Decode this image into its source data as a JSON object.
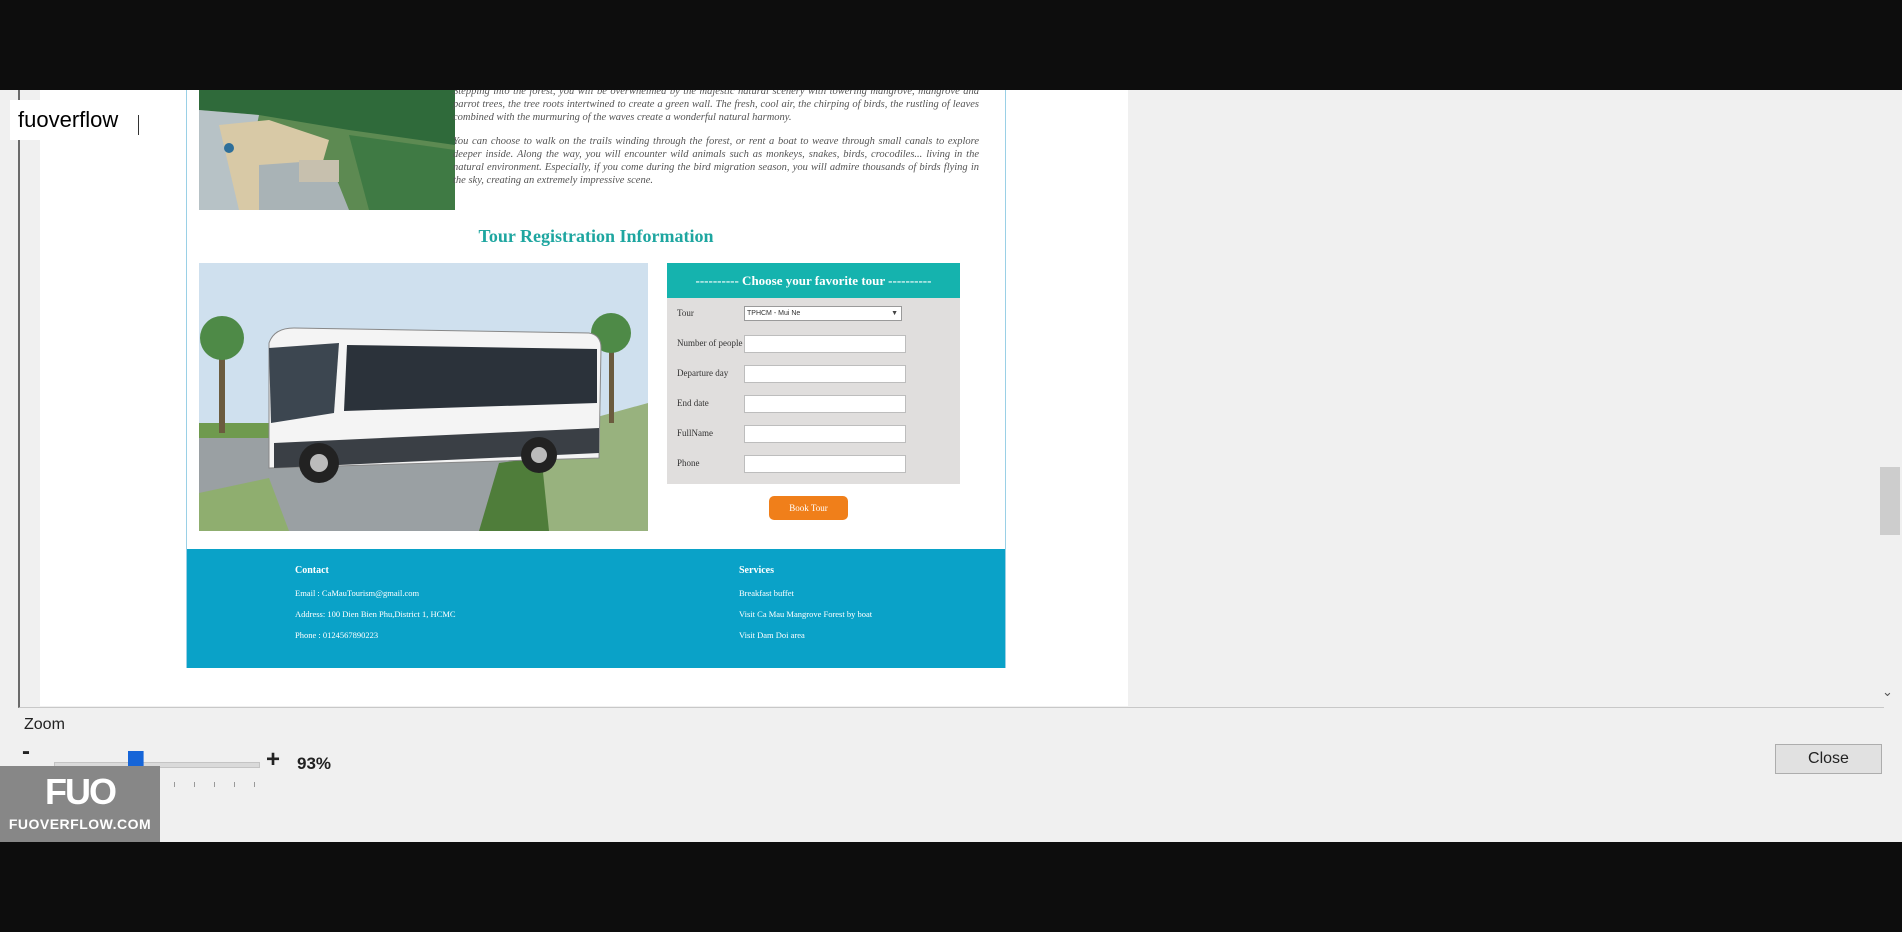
{
  "watermark": {
    "name": "fuoverflow"
  },
  "document": {
    "intro_paragraph_1": "Stepping into the forest, you will be overwhelmed by the majestic natural scenery with towering mangrove, mangrove and parrot trees, the tree roots intertwined to create a green wall. The fresh, cool air, the chirping of birds, the rustling of leaves combined with the murmuring of the waves create a wonderful natural harmony.",
    "intro_paragraph_2": "You can choose to walk on the trails winding through the forest, or rent a boat to weave through small canals to explore deeper inside. Along the way, you will encounter wild animals such as monkeys, snakes, birds, crocodiles... living in the natural environment. Especially, if you come during the bird migration season, you will admire thousands of birds flying in the sky, creating an extremely impressive scene.",
    "registration_title": "Tour Registration Information",
    "form": {
      "header": "---------- Choose your favorite tour ----------",
      "tour_label": "Tour",
      "tour_selected": "TPHCM - Mui Ne",
      "people_label": "Number of people",
      "departure_label": "Departure day",
      "end_label": "End date",
      "fullname_label": "FullName",
      "phone_label": "Phone",
      "book_button": "Book Tour"
    },
    "footer": {
      "contact_title": "Contact",
      "email": "Email : CaMauTourism@gmail.com",
      "address": "Address: 100 Dien Bien Phu,District 1, HCMC",
      "phone": "Phone : 0124567890223",
      "services_title": "Services",
      "service_1": "Breakfast buffet",
      "service_2": "Visit Ca Mau Mangrove Forest by boat",
      "service_3": "Visit Dam Doi area"
    }
  },
  "zoom": {
    "label": "Zoom",
    "minus": "-",
    "plus": "+",
    "value": "93%",
    "level_fraction": 0.4
  },
  "close_button": "Close",
  "logo": {
    "mark": "FUO",
    "site": "FUOVERFLOW.COM"
  },
  "colors": {
    "accent_teal": "#15b3ae",
    "footer_blue": "#0aa2c8",
    "book_orange": "#f07f1a",
    "slider_blue": "#1665d8"
  }
}
